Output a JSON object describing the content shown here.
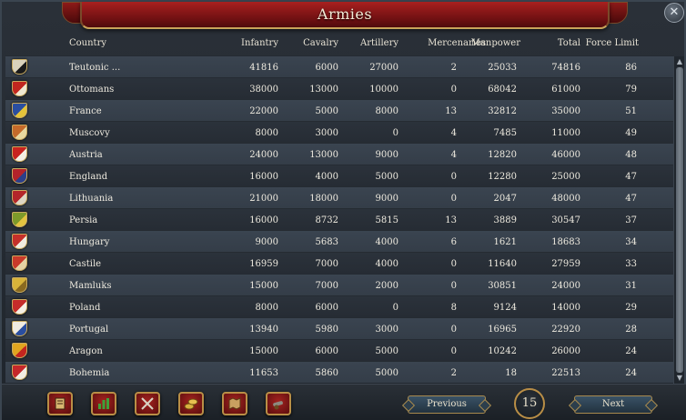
{
  "window": {
    "title": "Armies"
  },
  "columns": [
    "Country",
    "Infantry",
    "Cavalry",
    "Artillery",
    "Mercenaries",
    "Manpower",
    "Total",
    "Force Limit"
  ],
  "rows": [
    {
      "country": "Teutonic ...",
      "infantry": "41816",
      "cavalry": "6000",
      "artillery": "27000",
      "mercenaries": "2",
      "manpower": "25033",
      "total": "74816",
      "force_limit": "86",
      "shield": "#d9d2bc",
      "shield2": "#1a1a1a"
    },
    {
      "country": "Ottomans",
      "infantry": "38000",
      "cavalry": "13000",
      "artillery": "10000",
      "mercenaries": "0",
      "manpower": "68042",
      "total": "61000",
      "force_limit": "79",
      "shield": "#c1271f",
      "shield2": "#f0e8d0"
    },
    {
      "country": "France",
      "infantry": "22000",
      "cavalry": "5000",
      "artillery": "8000",
      "mercenaries": "13",
      "manpower": "32812",
      "total": "35000",
      "force_limit": "51",
      "shield": "#2a4ea0",
      "shield2": "#e5c43a"
    },
    {
      "country": "Muscovy",
      "infantry": "8000",
      "cavalry": "3000",
      "artillery": "0",
      "mercenaries": "4",
      "manpower": "7485",
      "total": "11000",
      "force_limit": "49",
      "shield": "#c46a2a",
      "shield2": "#e8d8a0"
    },
    {
      "country": "Austria",
      "infantry": "24000",
      "cavalry": "13000",
      "artillery": "9000",
      "mercenaries": "4",
      "manpower": "12820",
      "total": "46000",
      "force_limit": "48",
      "shield": "#c8231f",
      "shield2": "#f4efe4"
    },
    {
      "country": "England",
      "infantry": "16000",
      "cavalry": "4000",
      "artillery": "5000",
      "mercenaries": "0",
      "manpower": "12280",
      "total": "25000",
      "force_limit": "47",
      "shield": "#b3232a",
      "shield2": "#2b3f8a"
    },
    {
      "country": "Lithuania",
      "infantry": "21000",
      "cavalry": "18000",
      "artillery": "9000",
      "mercenaries": "0",
      "manpower": "2047",
      "total": "48000",
      "force_limit": "47",
      "shield": "#b3262a",
      "shield2": "#ddd6c4"
    },
    {
      "country": "Persia",
      "infantry": "16000",
      "cavalry": "8732",
      "artillery": "5815",
      "mercenaries": "13",
      "manpower": "3889",
      "total": "30547",
      "force_limit": "37",
      "shield": "#7d9a2a",
      "shield2": "#e3c440"
    },
    {
      "country": "Hungary",
      "infantry": "9000",
      "cavalry": "5683",
      "artillery": "4000",
      "mercenaries": "6",
      "manpower": "1621",
      "total": "18683",
      "force_limit": "34",
      "shield": "#c4302a",
      "shield2": "#f0ece0"
    },
    {
      "country": "Castile",
      "infantry": "16959",
      "cavalry": "7000",
      "artillery": "4000",
      "mercenaries": "0",
      "manpower": "11640",
      "total": "27959",
      "force_limit": "33",
      "shield": "#c83a2a",
      "shield2": "#e6d3a4"
    },
    {
      "country": "Mamluks",
      "infantry": "15000",
      "cavalry": "7000",
      "artillery": "2000",
      "mercenaries": "0",
      "manpower": "30851",
      "total": "24000",
      "force_limit": "31",
      "shield": "#d8b43a",
      "shield2": "#8a6a20"
    },
    {
      "country": "Poland",
      "infantry": "8000",
      "cavalry": "6000",
      "artillery": "0",
      "mercenaries": "8",
      "manpower": "9124",
      "total": "14000",
      "force_limit": "29",
      "shield": "#c42c2a",
      "shield2": "#f4efe4"
    },
    {
      "country": "Portugal",
      "infantry": "13940",
      "cavalry": "5980",
      "artillery": "3000",
      "mercenaries": "0",
      "manpower": "16965",
      "total": "22920",
      "force_limit": "28",
      "shield": "#f0ebe0",
      "shield2": "#2a4ea0"
    },
    {
      "country": "Aragon",
      "infantry": "15000",
      "cavalry": "6000",
      "artillery": "5000",
      "mercenaries": "0",
      "manpower": "10242",
      "total": "26000",
      "force_limit": "24",
      "shield": "#e0a520",
      "shield2": "#c2261f"
    },
    {
      "country": "Bohemia",
      "infantry": "11653",
      "cavalry": "5860",
      "artillery": "5000",
      "mercenaries": "2",
      "manpower": "18",
      "total": "22513",
      "force_limit": "24",
      "shield": "#c4282a",
      "shield2": "#f2ede2"
    }
  ],
  "toolbar": {
    "buttons": [
      {
        "name": "ledger-button",
        "icon": "book-icon"
      },
      {
        "name": "economy-button",
        "icon": "bar-chart-icon"
      },
      {
        "name": "military-button",
        "icon": "crossed-swords-icon"
      },
      {
        "name": "trade-button",
        "icon": "coins-icon"
      },
      {
        "name": "provinces-button",
        "icon": "map-icon"
      },
      {
        "name": "navy-button",
        "icon": "cannon-icon"
      }
    ]
  },
  "pagination": {
    "previous_label": "Previous",
    "next_label": "Next",
    "page_number": "15"
  },
  "colors": {
    "title_bar": "#8c1a18",
    "gold_trim": "#b98e46",
    "row_light": "#3a4450",
    "row_dark": "#2b323b"
  }
}
